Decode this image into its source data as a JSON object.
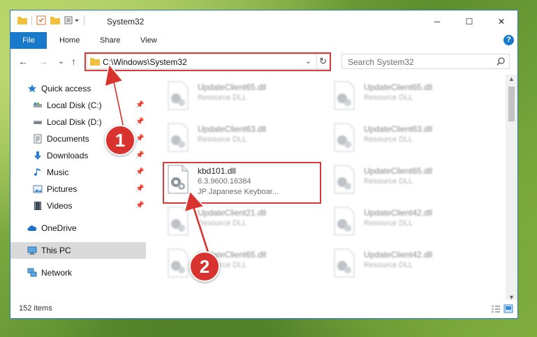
{
  "window": {
    "title": "System32",
    "controls": {
      "minimize": "─",
      "maximize": "☐",
      "close": "✕"
    }
  },
  "ribbon": {
    "tabs": [
      {
        "label": "File",
        "active": true
      },
      {
        "label": "Home"
      },
      {
        "label": "Share"
      },
      {
        "label": "View"
      }
    ],
    "help": "?"
  },
  "navigation": {
    "back": "←",
    "forward": "→",
    "recent": "⌄",
    "up": "↑",
    "address": "C:\\Windows\\System32",
    "refresh": "↻",
    "search_placeholder": "Search System32"
  },
  "sidebar": {
    "items": [
      {
        "label": "Quick access",
        "icon": "star-icon"
      },
      {
        "label": "Local Disk (C:)",
        "icon": "drive-icon",
        "pinned": true
      },
      {
        "label": "Local Disk (D:)",
        "icon": "drive-icon",
        "pinned": true
      },
      {
        "label": "Documents",
        "icon": "documents-icon",
        "pinned": true
      },
      {
        "label": "Downloads",
        "icon": "download-icon",
        "pinned": true
      },
      {
        "label": "Music",
        "icon": "music-icon",
        "pinned": true
      },
      {
        "label": "Pictures",
        "icon": "pictures-icon",
        "pinned": true
      },
      {
        "label": "Videos",
        "icon": "videos-icon",
        "pinned": true
      },
      {
        "label": "OneDrive",
        "icon": "cloud-icon"
      },
      {
        "label": "This PC",
        "icon": "computer-icon",
        "selected": true
      },
      {
        "label": "Network",
        "icon": "network-icon"
      }
    ]
  },
  "files": [
    {
      "name": "UpdateClient65.dll",
      "type": "Resource DLL"
    },
    {
      "name": "UpdateClient65.dll",
      "type": "Resource DLL"
    },
    {
      "name": "UpdateClient63.dll",
      "type": "Resource DLL"
    },
    {
      "name": "UpdateClient63.dll",
      "type": "Resource DLL"
    },
    {
      "name": "kbd101.dll",
      "version": "6.3.9600.16384",
      "description": "JP Japanese Keyboar...",
      "highlighted": true
    },
    {
      "name": "UpdateClient65.dll",
      "type": "Resource DLL"
    },
    {
      "name": "UpdateClient21.dll",
      "type": "Resource DLL"
    },
    {
      "name": "UpdateClient42.dll",
      "type": "Resource DLL"
    },
    {
      "name": "UpdateClient65.dll",
      "type": "Resource DLL"
    },
    {
      "name": "UpdateClient42.dll",
      "type": "Resource DLL"
    }
  ],
  "status": {
    "items_count": "152 items"
  },
  "annotations": {
    "badge1": "1",
    "badge2": "2"
  },
  "colors": {
    "accent": "#1979ca",
    "highlight_box": "#d83a3a",
    "badge": "#d8332f"
  }
}
